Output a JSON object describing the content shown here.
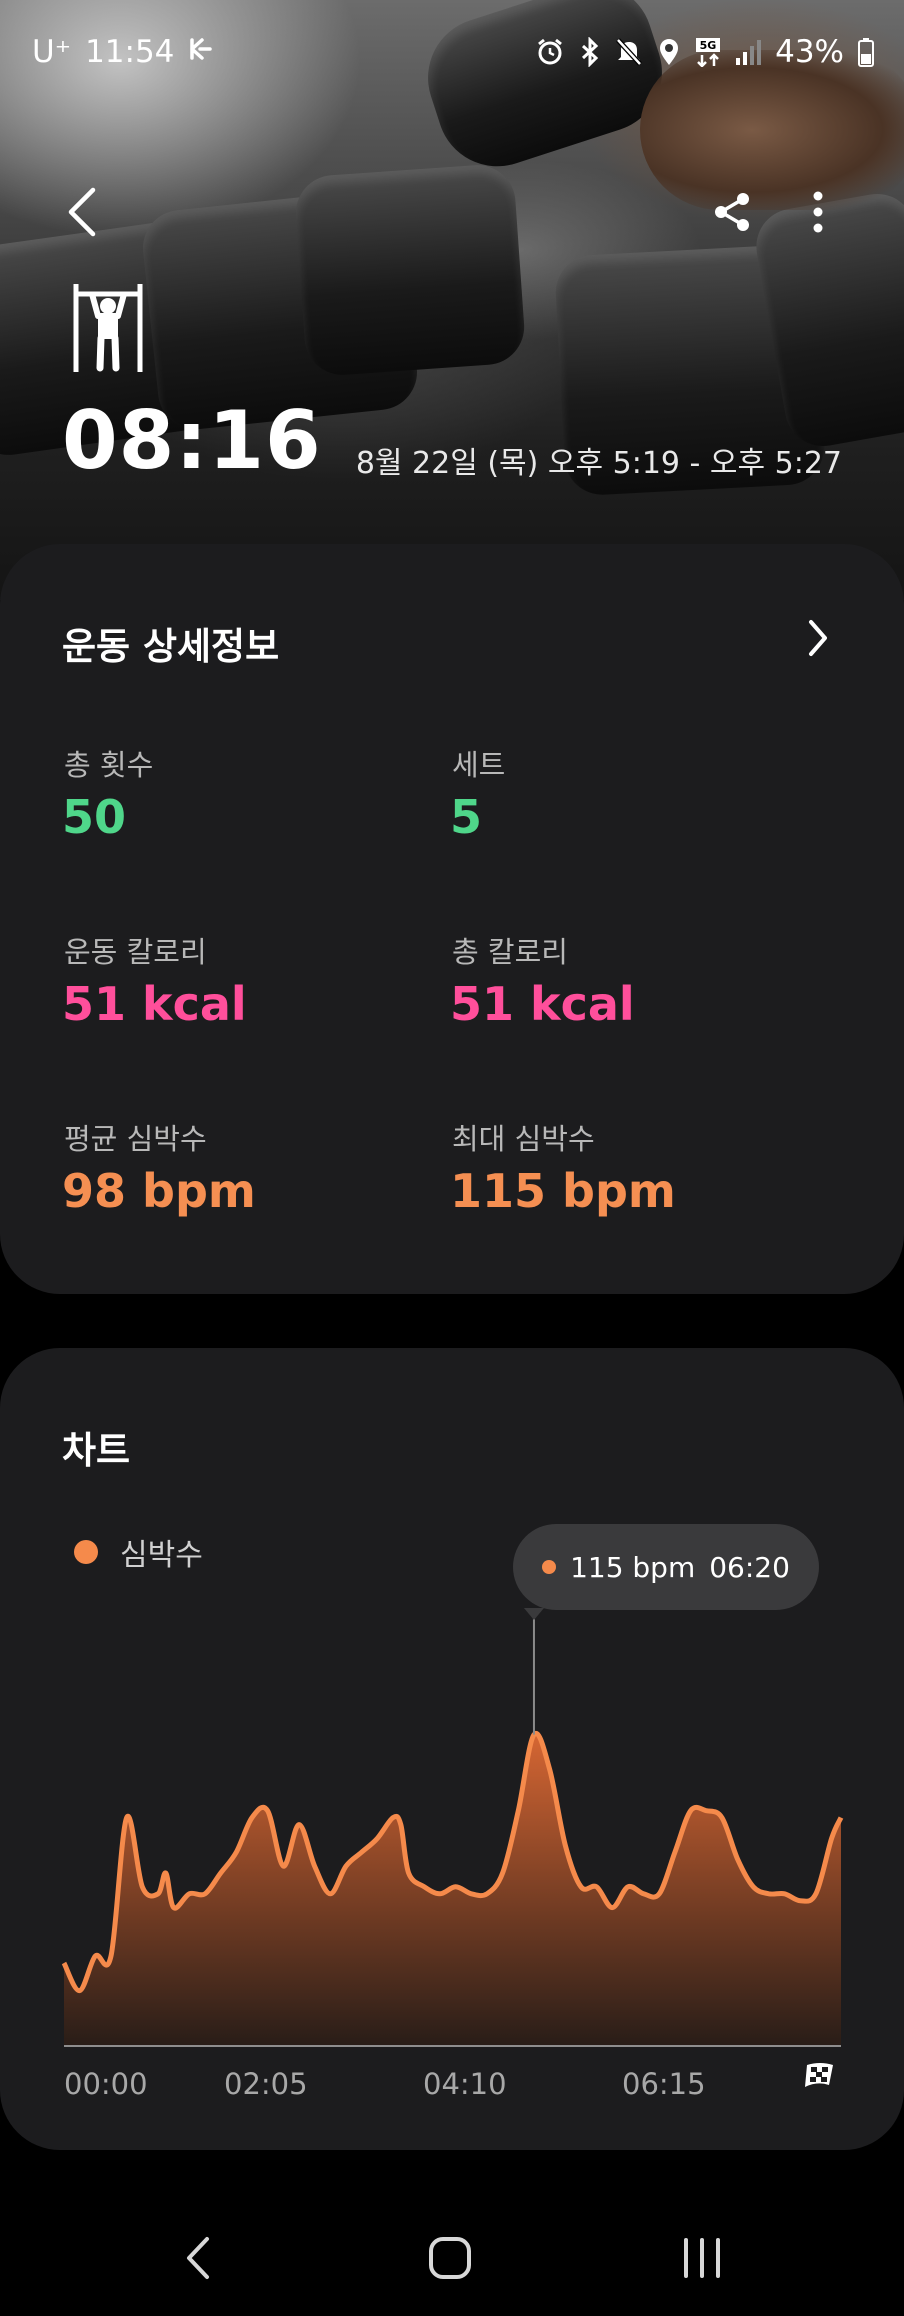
{
  "status_bar": {
    "carrier": "U⁺",
    "time": "11:54",
    "battery": "43%"
  },
  "header": {
    "back_icon": "chevron-left-icon",
    "share_icon": "share-icon",
    "more_icon": "more-vertical-icon",
    "workout_icon": "pull-up-bar-icon",
    "duration": "08:16",
    "date_range": "8월 22일 (목) 오후 5:19 - 오후 5:27"
  },
  "details": {
    "title": "운동 상세정보",
    "metrics": [
      {
        "label": "총 횟수",
        "value": "50",
        "color": "#4fd68a"
      },
      {
        "label": "세트",
        "value": "5",
        "color": "#4fd68a"
      },
      {
        "label": "운동 칼로리",
        "value": "51 kcal",
        "color": "#ff4f9b"
      },
      {
        "label": "총 칼로리",
        "value": "51 kcal",
        "color": "#ff4f9b"
      },
      {
        "label": "평균 심박수",
        "value": "98 bpm",
        "color": "#f58f52"
      },
      {
        "label": "최대 심박수",
        "value": "115 bpm",
        "color": "#f58f52"
      }
    ]
  },
  "chart_section": {
    "title": "차트",
    "legend": "심박수",
    "tooltip_value": "115 bpm",
    "tooltip_time": "06:20",
    "fullscreen_icon": "checkered-flag-icon"
  },
  "chart_data": {
    "type": "area",
    "series": [
      {
        "name": "심박수",
        "color": "#f58a4b"
      }
    ],
    "x_ticks": [
      "00:00",
      "02:05",
      "04:10",
      "06:15"
    ],
    "x_range_seconds": [
      0,
      496
    ],
    "y_range": [
      70,
      120
    ],
    "x": [
      0,
      10,
      20,
      30,
      40,
      50,
      60,
      65,
      70,
      80,
      90,
      100,
      110,
      120,
      130,
      140,
      150,
      160,
      170,
      180,
      190,
      200,
      210,
      215,
      220,
      230,
      240,
      250,
      260,
      270,
      280,
      290,
      300,
      310,
      320,
      330,
      340,
      350,
      360,
      370,
      380,
      390,
      400,
      410,
      420,
      430,
      440,
      450,
      460,
      470,
      480,
      490,
      496
    ],
    "values": [
      82,
      78,
      83,
      83,
      103,
      93,
      92,
      95,
      90,
      92,
      92,
      95,
      98,
      103,
      104,
      96,
      102,
      96,
      92,
      96,
      98,
      100,
      103,
      102,
      95,
      93,
      92,
      93,
      92,
      92,
      95,
      104,
      115,
      110,
      99,
      93,
      93,
      90,
      93,
      92,
      92,
      98,
      104,
      104,
      103,
      97,
      93,
      92,
      92,
      91,
      92,
      100,
      103
    ],
    "highlight": {
      "time": "06:20",
      "value": 115
    }
  },
  "nav_bar": {
    "back_icon": "nav-back-icon",
    "home_icon": "nav-home-icon",
    "recents_icon": "nav-recents-icon"
  }
}
